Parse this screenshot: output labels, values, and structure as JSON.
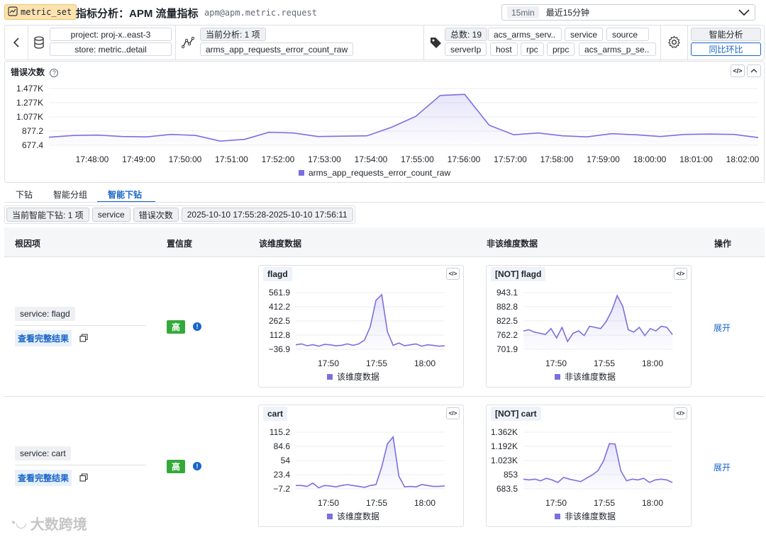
{
  "header": {
    "badge": "metric_set",
    "title": "指标分析：APM 流量指标",
    "subtitle": "apm@apm.metric.request",
    "time_short": "15min",
    "time_long": "最近15分钟"
  },
  "filters": {
    "project": "project: proj-x..east-3",
    "store": "store: metric..detail",
    "current_analysis": "当前分析: 1 项",
    "metric": "arms_app_requests_error_count_raw",
    "total": "总数: 19",
    "tags": [
      "acs_arms_serv..",
      "service",
      "source",
      "serverIp",
      "host",
      "rpc",
      "prpc",
      "acs_arms_p_se.."
    ],
    "smart_analysis": "智能分析",
    "yoy": "同比环比"
  },
  "main_chart": {
    "title": "错误次数",
    "legend": "arms_app_requests_error_count_raw"
  },
  "tabs": [
    "下钻",
    "智能分组",
    "智能下钻"
  ],
  "drill": {
    "current": "当前智能下钻: 1 项",
    "dimension": "service",
    "metric": "错误次数",
    "range": "2025-10-10 17:55:28-2025-10-10 17:56:11"
  },
  "table": {
    "headers": [
      "根因项",
      "置信度",
      "该维度数据",
      "非该维度数据",
      "操作"
    ],
    "rows": [
      {
        "root": "service: flagd",
        "view": "查看完整结果",
        "confidence": "高",
        "action": "展开",
        "dim_title": "flagd",
        "nondim_title": "[NOT] flagd"
      },
      {
        "root": "service: cart",
        "view": "查看完整结果",
        "confidence": "高",
        "action": "展开",
        "dim_title": "cart",
        "nondim_title": "[NOT] cart"
      }
    ],
    "dim_legend": "该维度数据",
    "nondim_legend": "非该维度数据"
  },
  "watermark": "大数跨境",
  "colors": {
    "accent": "#1664c8",
    "series": "#7b6fe0",
    "high": "#34a93a",
    "badge": "#fbe3b0"
  },
  "chart_data": [
    {
      "type": "area",
      "title": "错误次数",
      "series": [
        {
          "name": "arms_app_requests_error_count_raw",
          "x": [
            "17:47:30",
            "17:48:00",
            "17:48:30",
            "17:49:00",
            "17:49:30",
            "17:50:00",
            "17:50:30",
            "17:51:00",
            "17:51:30",
            "17:52:00",
            "17:52:30",
            "17:53:00",
            "17:53:30",
            "17:54:00",
            "17:54:30",
            "17:55:00",
            "17:55:30",
            "17:56:00",
            "17:56:30",
            "17:57:00",
            "17:57:30",
            "17:58:00",
            "17:58:30",
            "17:59:00",
            "17:59:30",
            "18:00:00",
            "18:00:30",
            "18:01:00",
            "18:01:30",
            "18:02:00"
          ],
          "values": [
            790,
            815,
            820,
            800,
            795,
            830,
            815,
            735,
            760,
            860,
            850,
            800,
            805,
            810,
            930,
            1085,
            1380,
            1395,
            960,
            825,
            850,
            810,
            795,
            840,
            825,
            800,
            830,
            835,
            830,
            785
          ]
        }
      ],
      "ytick_labels": [
        "1.477K",
        "1.277K",
        "1.077K",
        "877.2",
        "677.4"
      ],
      "xtick_labels": [
        "17:48:00",
        "17:49:00",
        "17:50:00",
        "17:51:00",
        "17:52:00",
        "17:53:00",
        "17:54:00",
        "17:55:00",
        "17:56:00",
        "17:57:00",
        "17:58:00",
        "17:59:00",
        "18:00:00",
        "18:01:00",
        "18:02:00"
      ],
      "ylim": [
        677.4,
        1477
      ]
    },
    {
      "type": "area",
      "title": "flagd",
      "series": [
        {
          "name": "该维度数据",
          "values": [
            10,
            20,
            0,
            12,
            -5,
            15,
            10,
            0,
            5,
            20,
            5,
            20,
            60,
            200,
            480,
            540,
            150,
            5,
            30,
            0,
            10,
            20,
            -5,
            10,
            5,
            -5,
            0
          ]
        }
      ],
      "ytick_labels": [
        "561.9",
        "412.2",
        "262.5",
        "112.8",
        "−36.9"
      ],
      "xtick_labels": [
        "17:50",
        "17:55",
        "18:00"
      ],
      "ylim": [
        -36.9,
        561.9
      ]
    },
    {
      "type": "area",
      "title": "[NOT] flagd",
      "series": [
        {
          "name": "非该维度数据",
          "values": [
            780,
            785,
            775,
            770,
            765,
            790,
            750,
            795,
            735,
            770,
            780,
            760,
            800,
            795,
            790,
            820,
            865,
            930,
            885,
            785,
            775,
            795,
            760,
            790,
            780,
            800,
            795,
            765
          ]
        }
      ],
      "ytick_labels": [
        "943.1",
        "882.8",
        "822.5",
        "762.2",
        "701.9"
      ],
      "xtick_labels": [
        "17:50",
        "17:55",
        "18:00"
      ],
      "ylim": [
        701.9,
        943.1
      ]
    },
    {
      "type": "area",
      "title": "cart",
      "series": [
        {
          "name": "该维度数据",
          "values": [
            0,
            0,
            -2,
            5,
            -5,
            0,
            -1,
            -3,
            0,
            2,
            0,
            -2,
            -4,
            0,
            2,
            40,
            90,
            105,
            20,
            -3,
            -2,
            -3,
            2,
            0,
            -2,
            -2,
            -1
          ]
        }
      ],
      "ytick_labels": [
        "115.2",
        "84.6",
        "54",
        "23.4",
        "−7.2"
      ],
      "xtick_labels": [
        "17:50",
        "17:55",
        "18:00"
      ],
      "ylim": [
        -7.2,
        115.2
      ]
    },
    {
      "type": "area",
      "title": "[NOT] cart",
      "series": [
        {
          "name": "非该维度数据",
          "values": [
            800,
            790,
            800,
            780,
            810,
            790,
            760,
            820,
            800,
            785,
            770,
            810,
            850,
            900,
            1020,
            1225,
            1220,
            900,
            780,
            800,
            790,
            810,
            760,
            790,
            800,
            790,
            760
          ]
        }
      ],
      "ytick_labels": [
        "1.362K",
        "1.192K",
        "1.023K",
        "853",
        "683.5"
      ],
      "xtick_labels": [
        "17:50",
        "17:55",
        "18:00"
      ],
      "ylim": [
        683.5,
        1362
      ]
    }
  ]
}
